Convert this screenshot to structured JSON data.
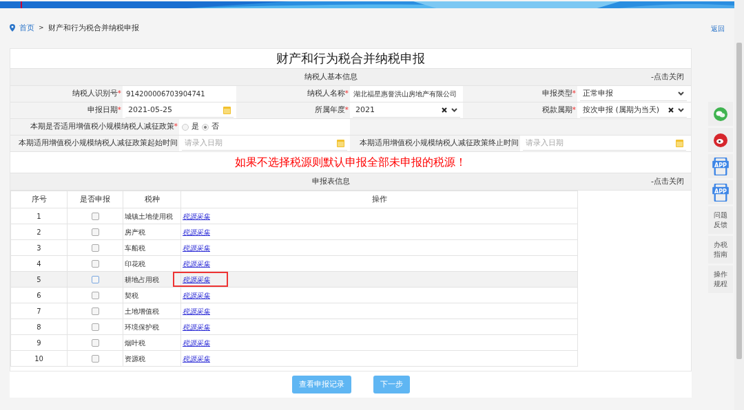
{
  "breadcrumb": {
    "home": "首页",
    "separator": ">",
    "current": "财产和行为税合并纳税申报",
    "back": "返回"
  },
  "title": "财产和行为税合并纳税申报",
  "basic_info": {
    "title": "纳税人基本信息",
    "toggle": "-点击关闭",
    "rows": [
      {
        "kind": "triple",
        "fields": [
          {
            "label": "纳税人识别号",
            "required_mark": "*",
            "kind": "text",
            "value": "914200006703904741"
          },
          {
            "label": "纳税人名称",
            "required_mark": "*",
            "kind": "text",
            "value": "湖北福星惠誉洪山房地产有限公司"
          },
          {
            "label": "申报类型",
            "required_mark": "*",
            "kind": "select",
            "value": "正常申报"
          }
        ]
      },
      {
        "kind": "triple",
        "fields": [
          {
            "label": "申报日期",
            "required_mark": "*",
            "kind": "date",
            "value": "2021-05-25"
          },
          {
            "label": "所属年度",
            "required_mark": "*",
            "kind": "clear-select",
            "value": "2021"
          },
          {
            "label": "税款属期",
            "required_mark": "*",
            "kind": "clear-select",
            "value": "按次申报 (属期为当天)"
          }
        ]
      },
      {
        "kind": "radio",
        "label": "本期是否适用增值税小规模纳税人减征政策",
        "required_mark": "*",
        "options": [
          {
            "label": "是",
            "selected": false
          },
          {
            "label": "否",
            "selected": true
          }
        ]
      },
      {
        "kind": "pair",
        "fields": [
          {
            "label": "本期适用增值税小规模纳税人减征政策起始时间",
            "kind": "date",
            "placeholder": "请录入日期"
          },
          {
            "label": "本期适用增值税小规模纳税人减征政策终止时间",
            "kind": "date",
            "placeholder": "请录入日期"
          }
        ]
      }
    ]
  },
  "notice": "如果不选择税源则默认申报全部未申报的税源！",
  "report_table": {
    "title": "申报表信息",
    "toggle": "-点击关闭",
    "columns": [
      "序号",
      "是否申报",
      "税种",
      "操作"
    ],
    "rows": [
      {
        "index": "1",
        "checked": false,
        "tax": "城镇土地使用税",
        "action": "税源采集",
        "highlighted": false
      },
      {
        "index": "2",
        "checked": false,
        "tax": "房产税",
        "action": "税源采集",
        "highlighted": false
      },
      {
        "index": "3",
        "checked": false,
        "tax": "车船税",
        "action": "税源采集",
        "highlighted": false
      },
      {
        "index": "4",
        "checked": false,
        "tax": "印花税",
        "action": "税源采集",
        "highlighted": false
      },
      {
        "index": "5",
        "checked": false,
        "tax": "耕地占用税",
        "action": "税源采集",
        "highlighted": true
      },
      {
        "index": "6",
        "checked": false,
        "tax": "契税",
        "action": "税源采集",
        "highlighted": false
      },
      {
        "index": "7",
        "checked": false,
        "tax": "土地增值税",
        "action": "税源采集",
        "highlighted": false
      },
      {
        "index": "8",
        "checked": false,
        "tax": "环境保护税",
        "action": "税源采集",
        "highlighted": false
      },
      {
        "index": "9",
        "checked": false,
        "tax": "烟叶税",
        "action": "税源采集",
        "highlighted": false
      },
      {
        "index": "10",
        "checked": false,
        "tax": "资源税",
        "action": "税源采集",
        "highlighted": false
      }
    ]
  },
  "buttons": [
    "查看申报记录",
    "下一步"
  ],
  "side_toolbar": [
    {
      "kind": "wechat"
    },
    {
      "kind": "weibo"
    },
    {
      "kind": "app",
      "label": "APP"
    },
    {
      "kind": "app",
      "label": "APP"
    },
    {
      "kind": "text",
      "label": "问题反馈"
    },
    {
      "kind": "text",
      "label": "办税指南"
    },
    {
      "kind": "text",
      "label": "操作规程"
    }
  ]
}
